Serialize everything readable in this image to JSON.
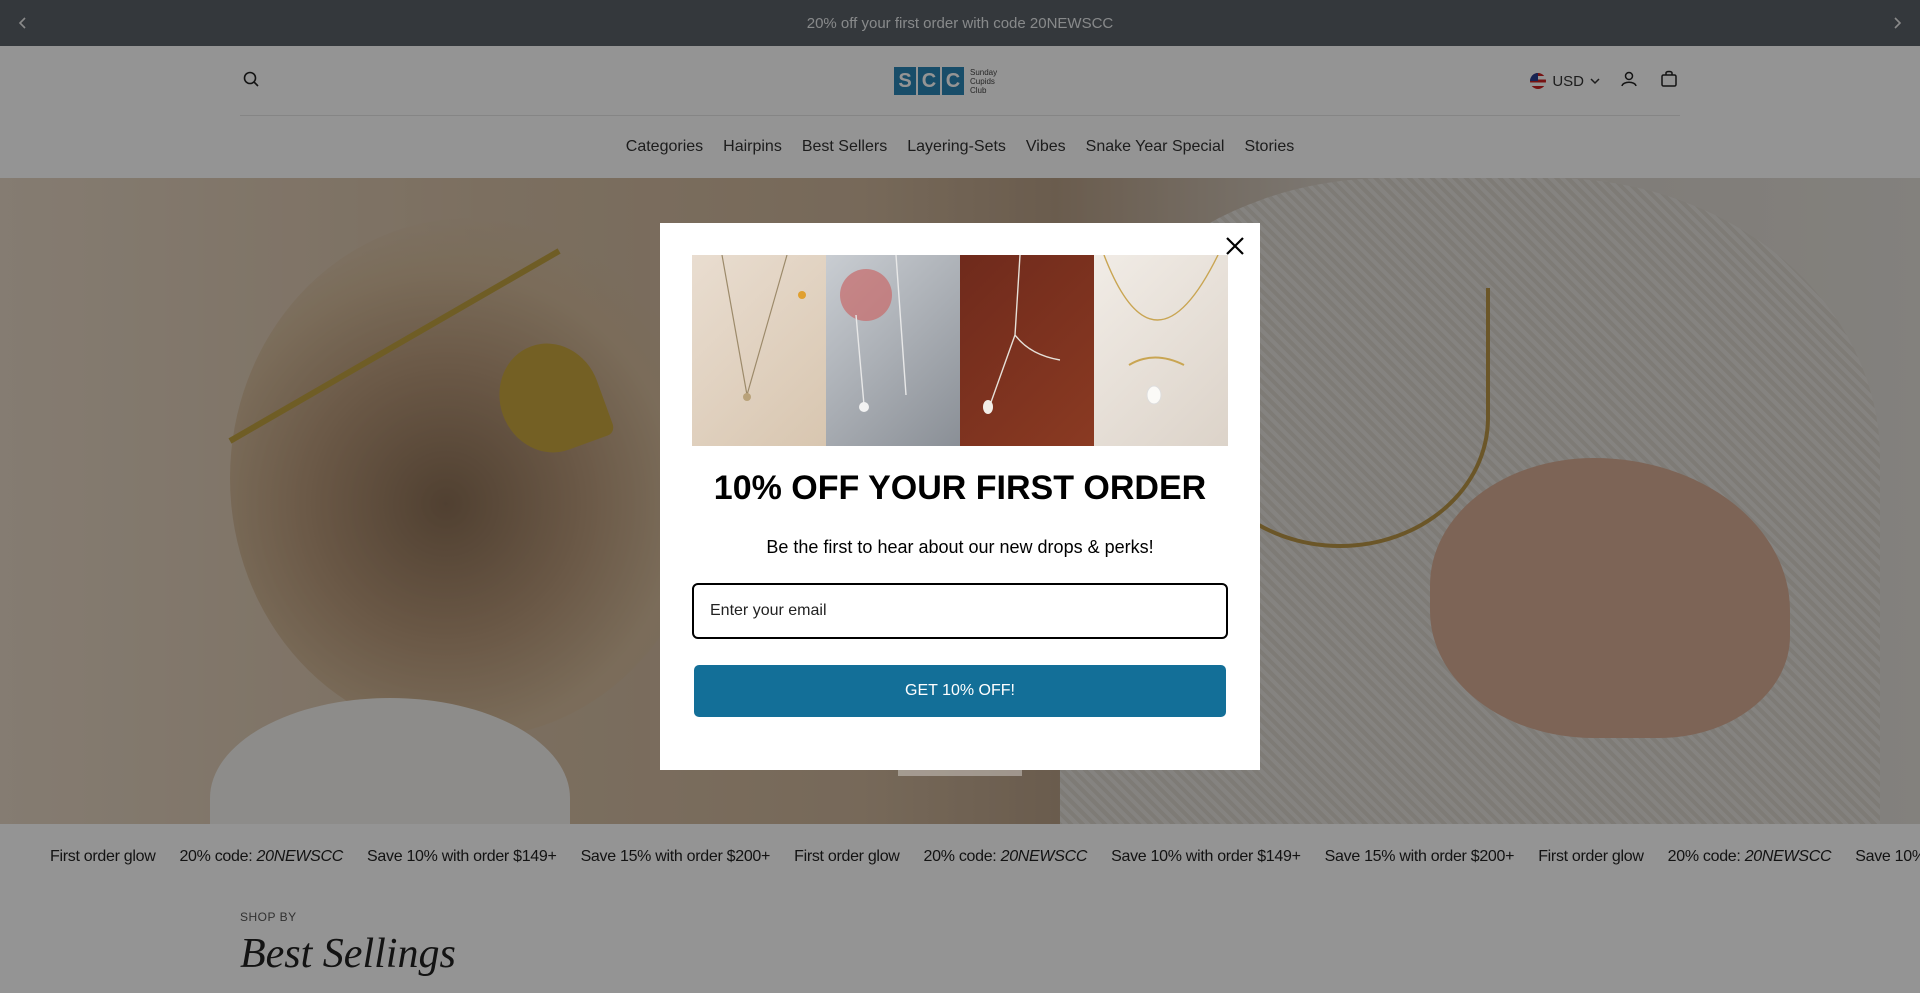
{
  "announcement": {
    "text": "20% off your first order with code 20NEWSCC",
    "prev_icon": "chevron-left-icon",
    "next_icon": "chevron-right-icon"
  },
  "header": {
    "logo_mark": [
      "S",
      "C",
      "C"
    ],
    "logo_text": [
      "Sunday",
      "Cupids",
      "Club"
    ],
    "currency": "USD",
    "icons": [
      "search-icon",
      "account-icon",
      "cart-icon"
    ]
  },
  "nav": {
    "items": [
      "Categories",
      "Hairpins",
      "Best Sellers",
      "Layering-Sets",
      "Vibes",
      "Snake Year Special",
      "Stories"
    ]
  },
  "marquee": {
    "items": [
      {
        "label": "First order glow",
        "code": ""
      },
      {
        "label": "20% code: ",
        "code": "20NEWSCC"
      },
      {
        "label": "Save 10% with order $149+",
        "code": ""
      },
      {
        "label": "Save 15% with order $200+",
        "code": ""
      },
      {
        "label": "First order glow",
        "code": ""
      },
      {
        "label": "20% code: ",
        "code": "20NEWSCC"
      },
      {
        "label": "Save 10% with order $149+",
        "code": ""
      },
      {
        "label": "Save 15% with order $200+",
        "code": ""
      },
      {
        "label": "First order glow",
        "code": ""
      },
      {
        "label": "20% code: ",
        "code": "20NEWSCC"
      },
      {
        "label": "Save 10% w",
        "code": ""
      }
    ]
  },
  "section": {
    "kicker": "SHOP BY",
    "title": "Best Sellings"
  },
  "modal": {
    "title": "10% OFF YOUR FIRST ORDER",
    "subtitle": "Be the first to hear about our new drops & perks!",
    "email_placeholder": "Enter your email",
    "button_label": "GET 10% OFF!",
    "button_color": "#136f98"
  }
}
